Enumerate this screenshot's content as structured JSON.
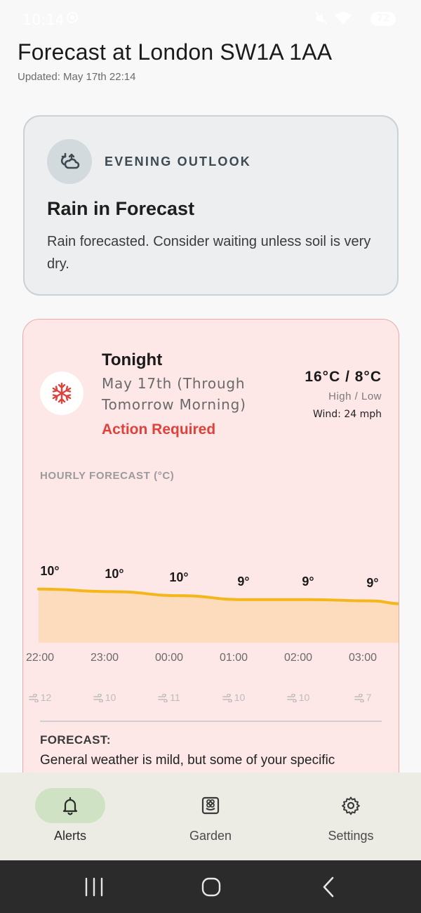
{
  "status_bar": {
    "time": "10:14",
    "battery": "72",
    "icons": [
      "screen-record-icon",
      "mute-icon",
      "wifi-icon",
      "battery-icon"
    ]
  },
  "header": {
    "title": "Forecast at London SW1A 1AA",
    "updated": "Updated: May 17th 22:14"
  },
  "outlook_card": {
    "icon": "cloud-sync-icon",
    "eyebrow": "EVENING OUTLOOK",
    "title": "Rain in Forecast",
    "body": "Rain forecasted. Consider waiting unless soil is very dry."
  },
  "tonight_card": {
    "icon": "snowflake-icon",
    "title": "Tonight",
    "date": "May 17th (Through Tomorrow Morning)",
    "status": "Action Required",
    "temps": "16°C / 8°C",
    "highlow": "High / Low",
    "wind": "Wind: 24 mph",
    "hourly_label": "HOURLY FORECAST (°C)",
    "hours": [
      {
        "time": "22:00",
        "temp": "10°",
        "wind": "12"
      },
      {
        "time": "23:00",
        "temp": "10°",
        "wind": "10"
      },
      {
        "time": "00:00",
        "temp": "10°",
        "wind": "11"
      },
      {
        "time": "01:00",
        "temp": "9°",
        "wind": "10"
      },
      {
        "time": "02:00",
        "temp": "9°",
        "wind": "10"
      },
      {
        "time": "03:00",
        "temp": "9°",
        "wind": "7"
      }
    ],
    "forecast_label": "FORECAST:",
    "forecast_text": "General weather is mild, but some of your specific"
  },
  "chart_data": {
    "type": "area",
    "x": [
      "22:00",
      "23:00",
      "00:00",
      "01:00",
      "02:00",
      "03:00"
    ],
    "series": [
      {
        "values": [
          10.4,
          10.2,
          9.9,
          9.6,
          9.6,
          9.5
        ]
      }
    ],
    "ylabel": "",
    "title": "HOURLY FORECAST (°C)"
  },
  "bottom_nav": {
    "items": [
      {
        "label": "Alerts",
        "icon": "bell-icon",
        "active": true
      },
      {
        "label": "Garden",
        "icon": "flower-icon",
        "active": false
      },
      {
        "label": "Settings",
        "icon": "gear-icon",
        "active": false
      }
    ]
  },
  "colors": {
    "accent_red": "#e0413a",
    "line_yellow": "#f4b619",
    "area_fill": "#fddcbd",
    "nav_active": "#cfe3c4"
  }
}
